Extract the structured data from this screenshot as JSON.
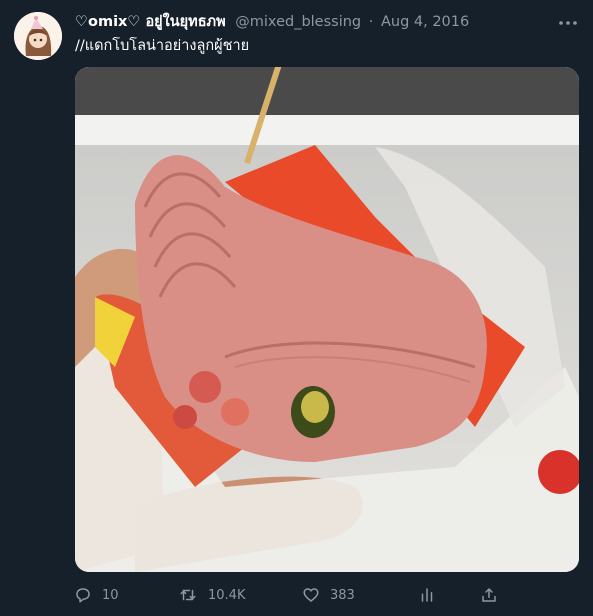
{
  "tweet": {
    "display_name": "♡omix♡ อยู่ในยุทธภพ",
    "handle": "@mixed_blessing",
    "separator": "·",
    "date": "Aug 4, 2016",
    "text": "//แดกโบโลน่าอย่างลูกผู้ชาย",
    "media_alt": "photo",
    "stats": {
      "replies": "10",
      "retweets": "10.4K",
      "likes": "383"
    }
  },
  "icons": {
    "more": "more-dots-icon",
    "reply": "reply-bubble-icon",
    "retweet": "retweet-arrows-icon",
    "like": "heart-icon",
    "analytics": "bar-chart-icon",
    "share": "share-upload-icon"
  },
  "colors": {
    "background": "#15202b",
    "muted_text": "#8b98a5",
    "text": "#ffffff"
  }
}
